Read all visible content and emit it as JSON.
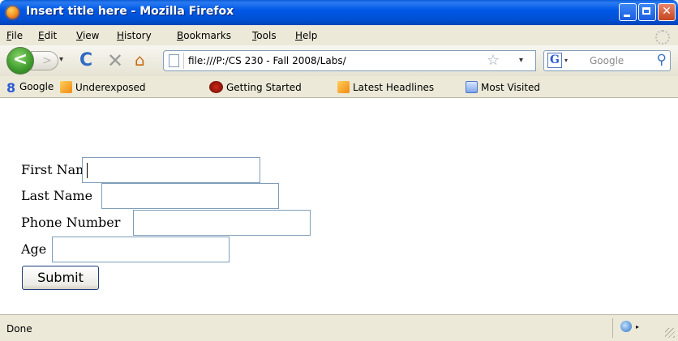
{
  "window": {
    "title": "Insert title here - Mozilla Firefox"
  },
  "menu": [
    "File",
    "Edit",
    "View",
    "History",
    "Bookmarks",
    "Tools",
    "Help"
  ],
  "nav": {
    "url": "file:///P:/CS 230 - Fall 2008/Labs/",
    "search_placeholder": "Google",
    "back_glyph": "<",
    "forward_glyph": ">",
    "reload_glyph": "C",
    "stop_glyph": "✕",
    "home_glyph": "⌂",
    "star_glyph": "☆",
    "search_glyph": "⚲",
    "dropdown_glyph": "▾"
  },
  "bookmarks": [
    {
      "label": "Google",
      "icon": "google-icon"
    },
    {
      "label": "Underexposed",
      "icon": "rss-icon"
    },
    {
      "label": "Getting Started",
      "icon": "getting-started-icon"
    },
    {
      "label": "Latest Headlines",
      "icon": "rss-icon"
    },
    {
      "label": "Most Visited",
      "icon": "most-visited-icon"
    }
  ],
  "form": {
    "first_name_label": "First Name",
    "last_name_label": "Last Name",
    "phone_label": "Phone Number",
    "age_label": "Age",
    "first_name_value": "",
    "last_name_value": "",
    "phone_value": "",
    "age_value": "",
    "submit_label": "Submit"
  },
  "status": {
    "text": "Done"
  },
  "colors": {
    "titlebar": "#0058e6",
    "chrome": "#ece9d8",
    "input_border": "#7f9db9"
  }
}
